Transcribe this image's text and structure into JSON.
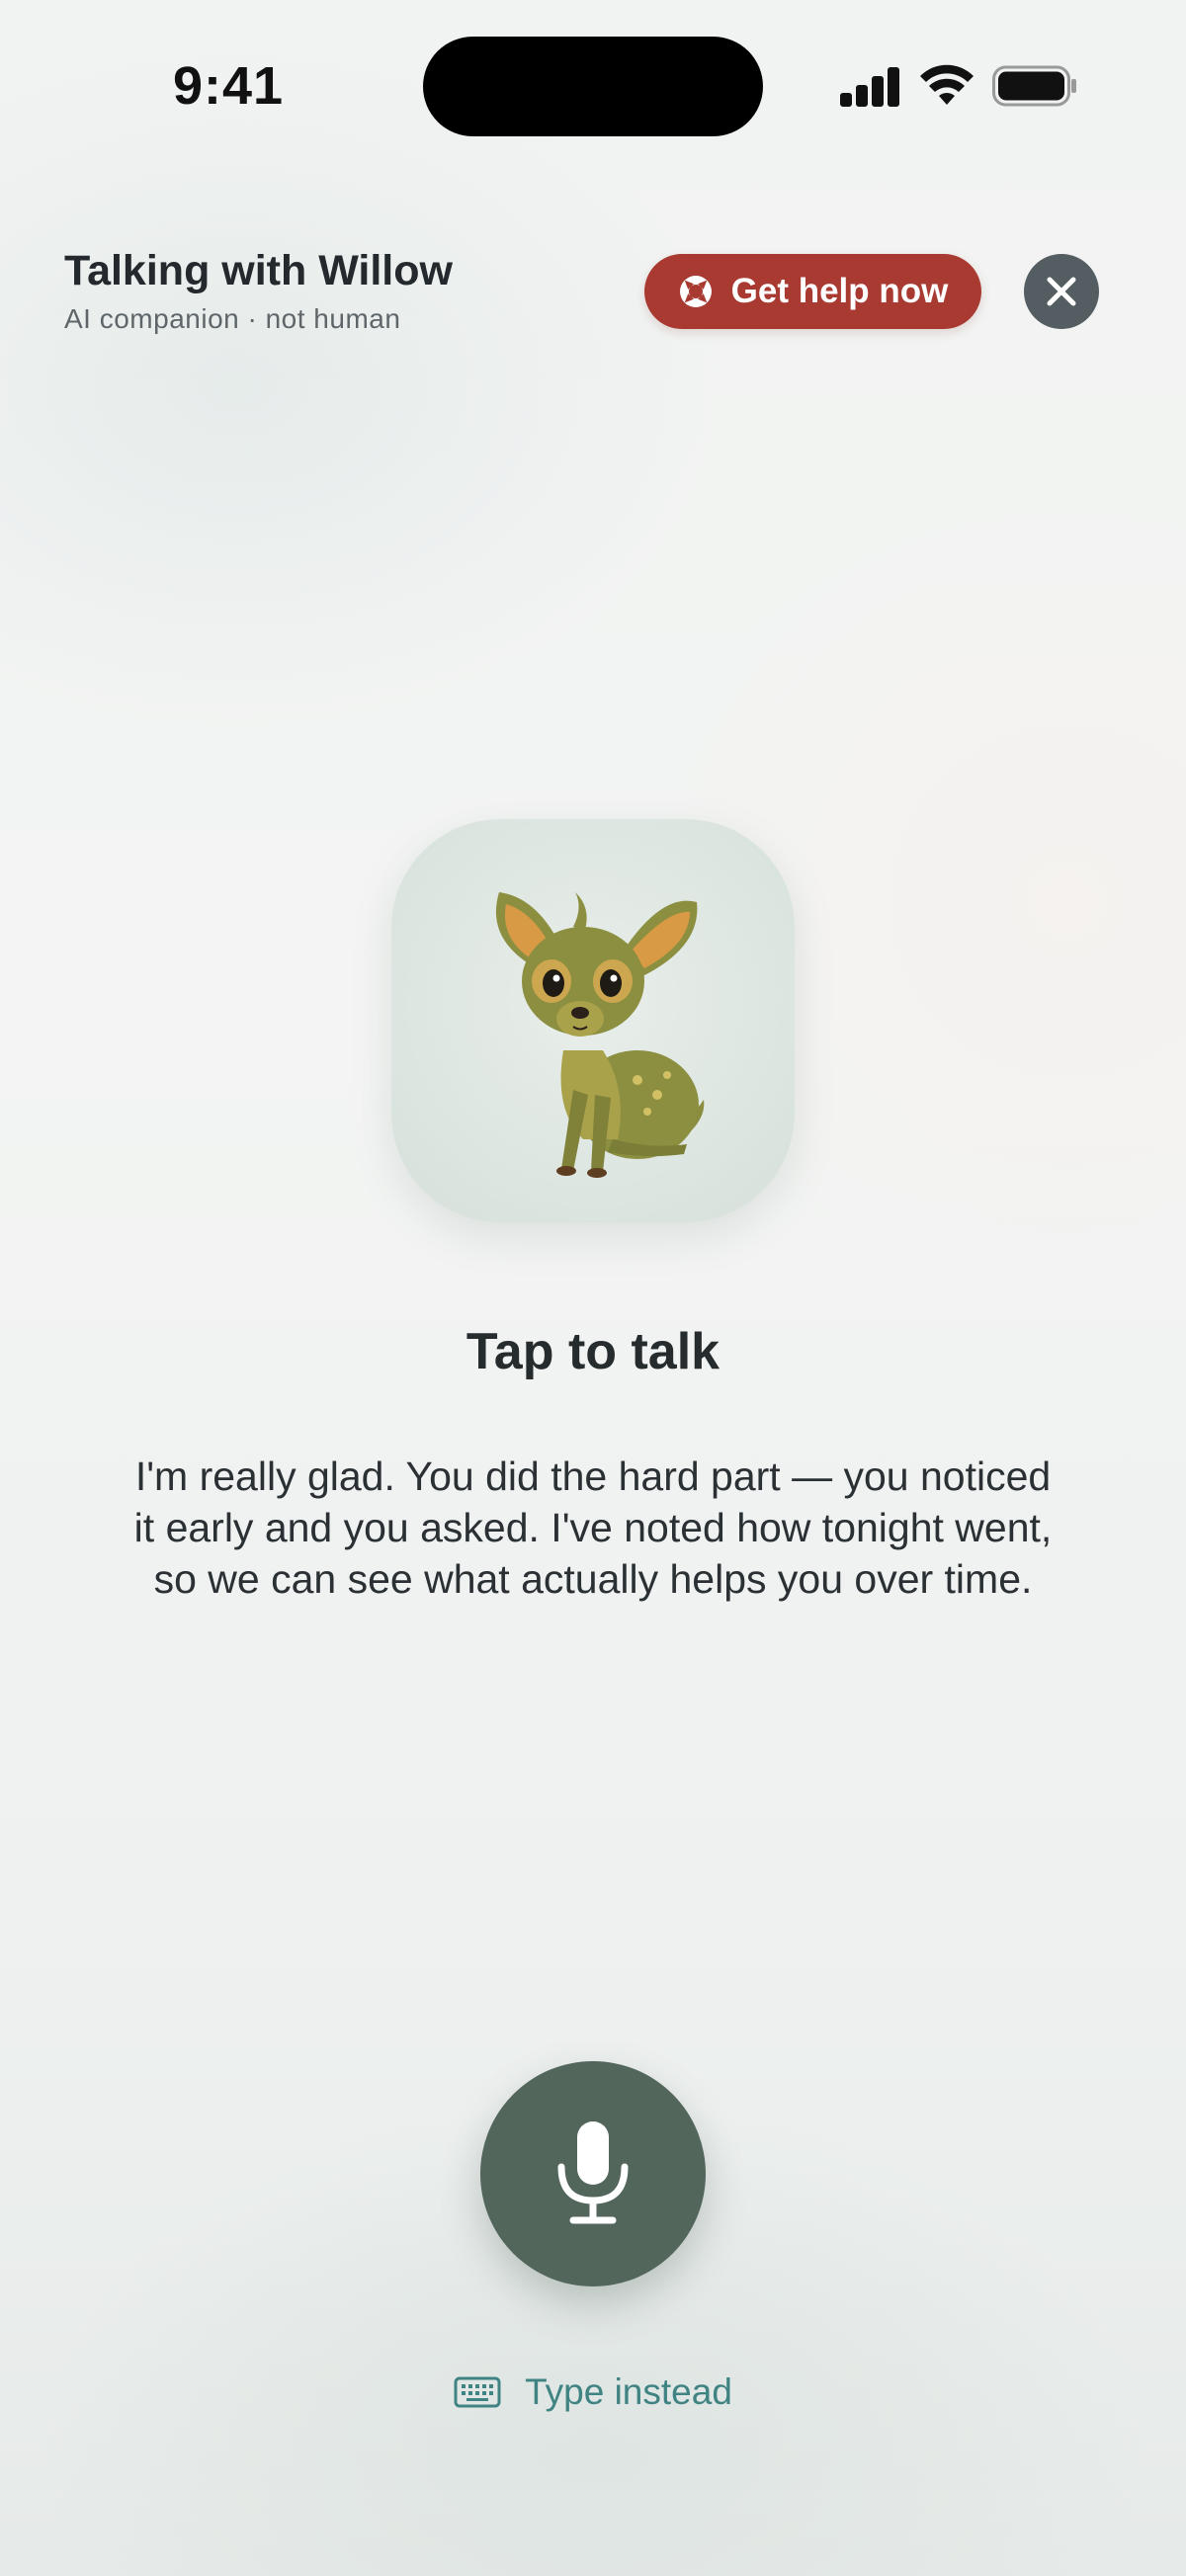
{
  "status_bar": {
    "time": "9:41"
  },
  "header": {
    "title": "Talking with Willow",
    "subtitle": "AI companion · not human",
    "help_label": "Get help now"
  },
  "companion": {
    "avatar_icon": "fawn-avatar"
  },
  "prompt": {
    "title": "Tap to talk"
  },
  "message": "I'm really glad. You did the hard part — you noticed it early and you asked. I've noted how tonight went, so we can see what actually helps you over time.",
  "footer": {
    "type_instead_label": "Type instead"
  },
  "colors": {
    "help_button": "#a83a31",
    "close_button": "#545d62",
    "mic_button": "#53665c",
    "link": "#3f8383"
  }
}
